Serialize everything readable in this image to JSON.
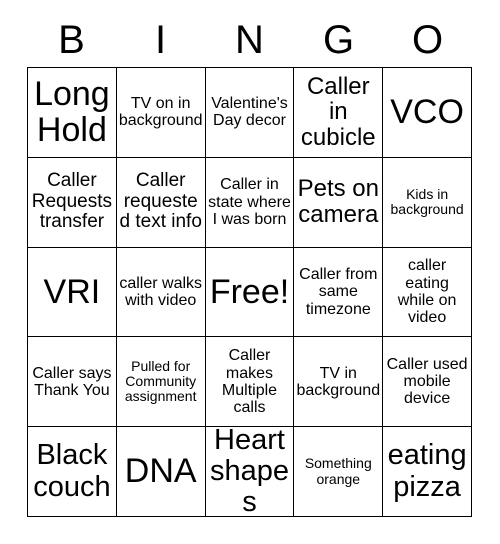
{
  "card": {
    "header_letters": [
      "B",
      "I",
      "N",
      "G",
      "O"
    ],
    "columns": 5,
    "rows": 5,
    "cells": [
      {
        "text": "Long Hold",
        "size": "s-xl"
      },
      {
        "text": "TV on in background",
        "size": "s-xs"
      },
      {
        "text": "Valentine's Day decor",
        "size": "s-xs"
      },
      {
        "text": "Caller in cubicle",
        "size": "s-md"
      },
      {
        "text": "VCO",
        "size": "s-xl"
      },
      {
        "text": "Caller Requests transfer",
        "size": "s-sm"
      },
      {
        "text": "Caller requested text info",
        "size": "s-sm"
      },
      {
        "text": "Caller in state where I was born",
        "size": "s-xs"
      },
      {
        "text": "Pets on camera",
        "size": "s-md"
      },
      {
        "text": "Kids in background",
        "size": "s-xxs"
      },
      {
        "text": "VRI",
        "size": "s-xl"
      },
      {
        "text": "caller walks with video",
        "size": "s-xs"
      },
      {
        "text": "Free!",
        "size": "s-xl"
      },
      {
        "text": "Caller from same timezone",
        "size": "s-xs"
      },
      {
        "text": "caller eating while on video",
        "size": "s-xs"
      },
      {
        "text": "Caller says Thank You",
        "size": "s-xs"
      },
      {
        "text": "Pulled for Community assignment",
        "size": "s-xxs"
      },
      {
        "text": "Caller makes Multiple calls",
        "size": "s-xs"
      },
      {
        "text": "TV in background",
        "size": "s-xs"
      },
      {
        "text": "Caller used mobile device",
        "size": "s-xs"
      },
      {
        "text": "Black couch",
        "size": "s-lg"
      },
      {
        "text": "DNA",
        "size": "s-xl"
      },
      {
        "text": "Heart shapes",
        "size": "s-lg"
      },
      {
        "text": "Something orange",
        "size": "s-xxs"
      },
      {
        "text": "eating pizza",
        "size": "s-lg"
      }
    ]
  }
}
